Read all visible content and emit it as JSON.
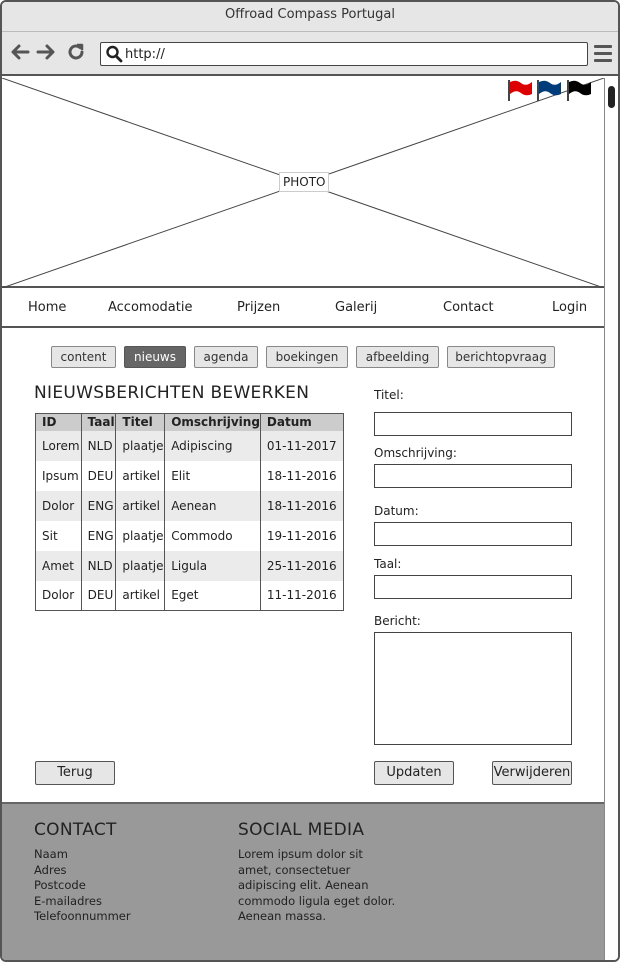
{
  "window": {
    "title": "Offroad Compass Portugal"
  },
  "browser": {
    "url": "http://"
  },
  "header": {
    "photo_label": "PHOTO",
    "flags": [
      {
        "name": "red-flag-icon",
        "color": "#dd0000"
      },
      {
        "name": "blue-flag-icon",
        "color": "#003c7a"
      },
      {
        "name": "black-flag-icon",
        "color": "#000000"
      }
    ]
  },
  "nav": {
    "items": [
      "Home",
      "Accomodatie",
      "Prijzen",
      "Galerij",
      "Contact",
      "Login"
    ]
  },
  "admin_tabs": {
    "items": [
      "content",
      "nieuws",
      "agenda",
      "boekingen",
      "afbeelding",
      "berichtopvraag"
    ],
    "active": "nieuws"
  },
  "news": {
    "title": "NIEUWSBERICHTEN BEWERKEN",
    "columns": [
      "ID",
      "Taal",
      "Titel",
      "Omschrijving",
      "Datum"
    ],
    "rows": [
      [
        "Lorem",
        "NLD",
        "plaatje",
        "Adipiscing",
        "01-11-2017"
      ],
      [
        "Ipsum",
        "DEU",
        "artikel",
        "Elit",
        "18-11-2016"
      ],
      [
        "Dolor",
        "ENG",
        "artikel",
        "Aenean",
        "18-11-2016"
      ],
      [
        "Sit",
        "ENG",
        "plaatje",
        "Commodo",
        "19-11-2016"
      ],
      [
        "Amet",
        "NLD",
        "plaatje",
        "Ligula",
        "25-11-2016"
      ],
      [
        "Dolor",
        "DEU",
        "artikel",
        "Eget",
        "11-11-2016"
      ]
    ]
  },
  "form": {
    "titel_label": "Titel:",
    "omschrijving_label": "Omschrijving:",
    "datum_label": "Datum:",
    "taal_label": "Taal:",
    "bericht_label": "Bericht:",
    "titel_value": "",
    "omschrijving_value": "",
    "datum_value": "",
    "taal_value": "",
    "bericht_value": ""
  },
  "buttons": {
    "back": "Terug",
    "update": "Updaten",
    "delete": "Verwijderen"
  },
  "footer": {
    "contact": {
      "title": "CONTACT",
      "lines": [
        "Naam",
        "Adres",
        "Postcode",
        "E-mailadres",
        "Telefoonnummer"
      ]
    },
    "social": {
      "title": "SOCIAL MEDIA",
      "lines": [
        "Lorem ipsum dolor sit",
        "amet, consectetuer",
        "adipiscing elit. Aenean",
        "commodo ligula eget dolor.",
        "Aenean massa."
      ]
    }
  }
}
